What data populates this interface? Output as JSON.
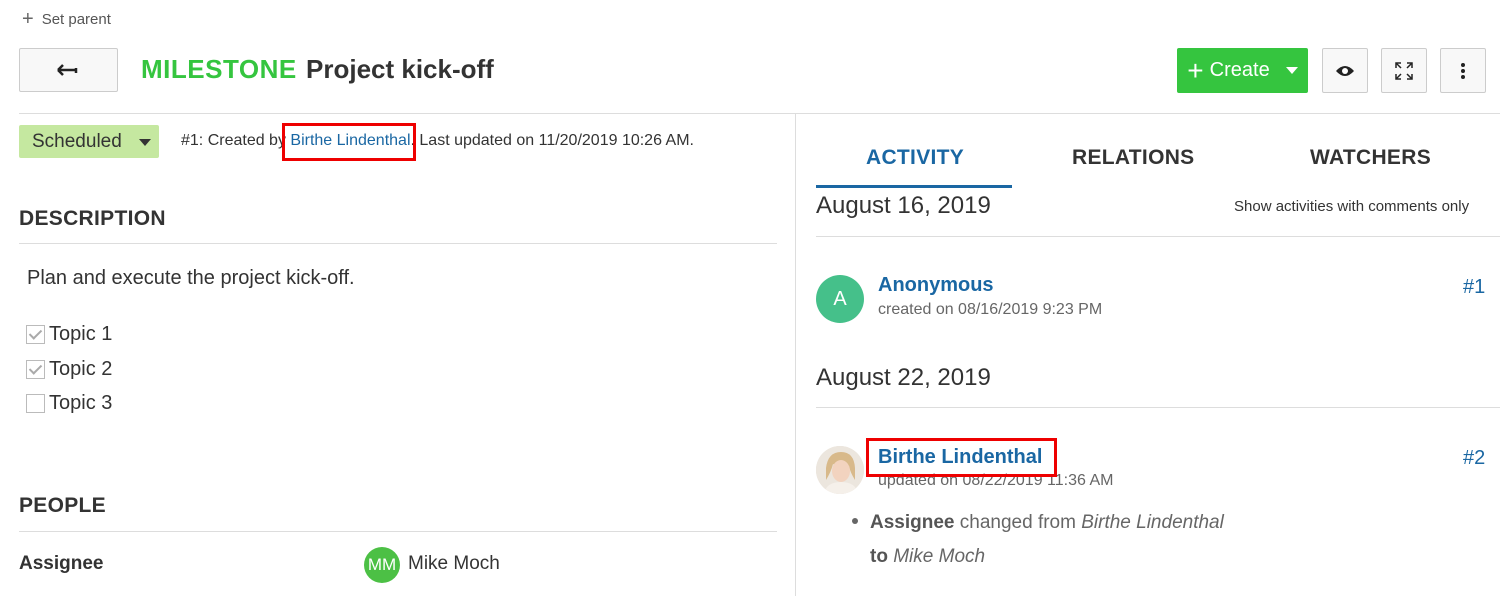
{
  "toolbar": {
    "set_parent": "Set parent",
    "create_label": "Create"
  },
  "header": {
    "type": "MILESTONE",
    "subject": "Project kick-off"
  },
  "status": {
    "label": "Scheduled"
  },
  "meta": {
    "prefix": "#1: Created by ",
    "author": "Birthe Lindenthal",
    "suffix": ". Last updated on 11/20/2019 10:26 AM."
  },
  "description": {
    "title": "DESCRIPTION",
    "text": "Plan and execute the project kick-off.",
    "tasks": [
      {
        "label": "Topic 1",
        "checked": true
      },
      {
        "label": "Topic 2",
        "checked": true
      },
      {
        "label": "Topic 3",
        "checked": false
      }
    ]
  },
  "people": {
    "title": "PEOPLE",
    "assignee_label": "Assignee",
    "assignee_initials": "MM",
    "assignee_name": "Mike Moch"
  },
  "tabs": [
    "ACTIVITY",
    "RELATIONS",
    "WATCHERS"
  ],
  "activity": {
    "comments_only": "Show activities with comments only",
    "groups": [
      {
        "date": "August 16, 2019",
        "entry": {
          "avatar_letter": "A",
          "user": "Anonymous",
          "sub": "created on 08/16/2019 9:23 PM",
          "number": "#1"
        }
      },
      {
        "date": "August 22, 2019",
        "entry": {
          "user": "Birthe Lindenthal",
          "sub": "updated on 08/22/2019 11:36 AM",
          "number": "#2",
          "change": {
            "field": "Assignee",
            "changed_from": "changed from",
            "old": "Birthe Lindenthal",
            "to": "to",
            "new": "Mike Moch"
          }
        }
      }
    ]
  },
  "colors": {
    "accent_green": "#35c53f",
    "link_blue": "#1a67a3",
    "status_green": "#c5e8a0",
    "highlight_red": "#e00000"
  }
}
